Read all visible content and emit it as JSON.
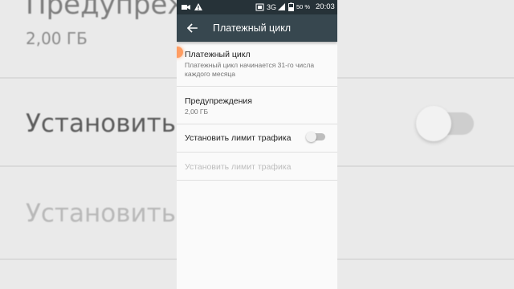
{
  "background": {
    "line1": "Предупрежд",
    "line2": "2,00 ГБ",
    "line3": "Установить ... ика",
    "line4": "Установить ... ика"
  },
  "status_bar": {
    "signal": "3G",
    "battery": "50 %",
    "time": "20:03"
  },
  "toolbar": {
    "title": "Платежный цикл"
  },
  "settings": [
    {
      "title": "Платежный цикл",
      "summary": "Платежный цикл начинается 31-го числа каждого месяца"
    },
    {
      "title": "Предупреждения",
      "summary": "2,00 ГБ"
    },
    {
      "title": "Установить лимит трафика",
      "toggle": "off"
    },
    {
      "title": "Установить лимит трафика",
      "disabled": true
    }
  ],
  "colors": {
    "status_bar": "#263238",
    "toolbar": "#37474f",
    "touch_indicator": "#ff8c46"
  }
}
